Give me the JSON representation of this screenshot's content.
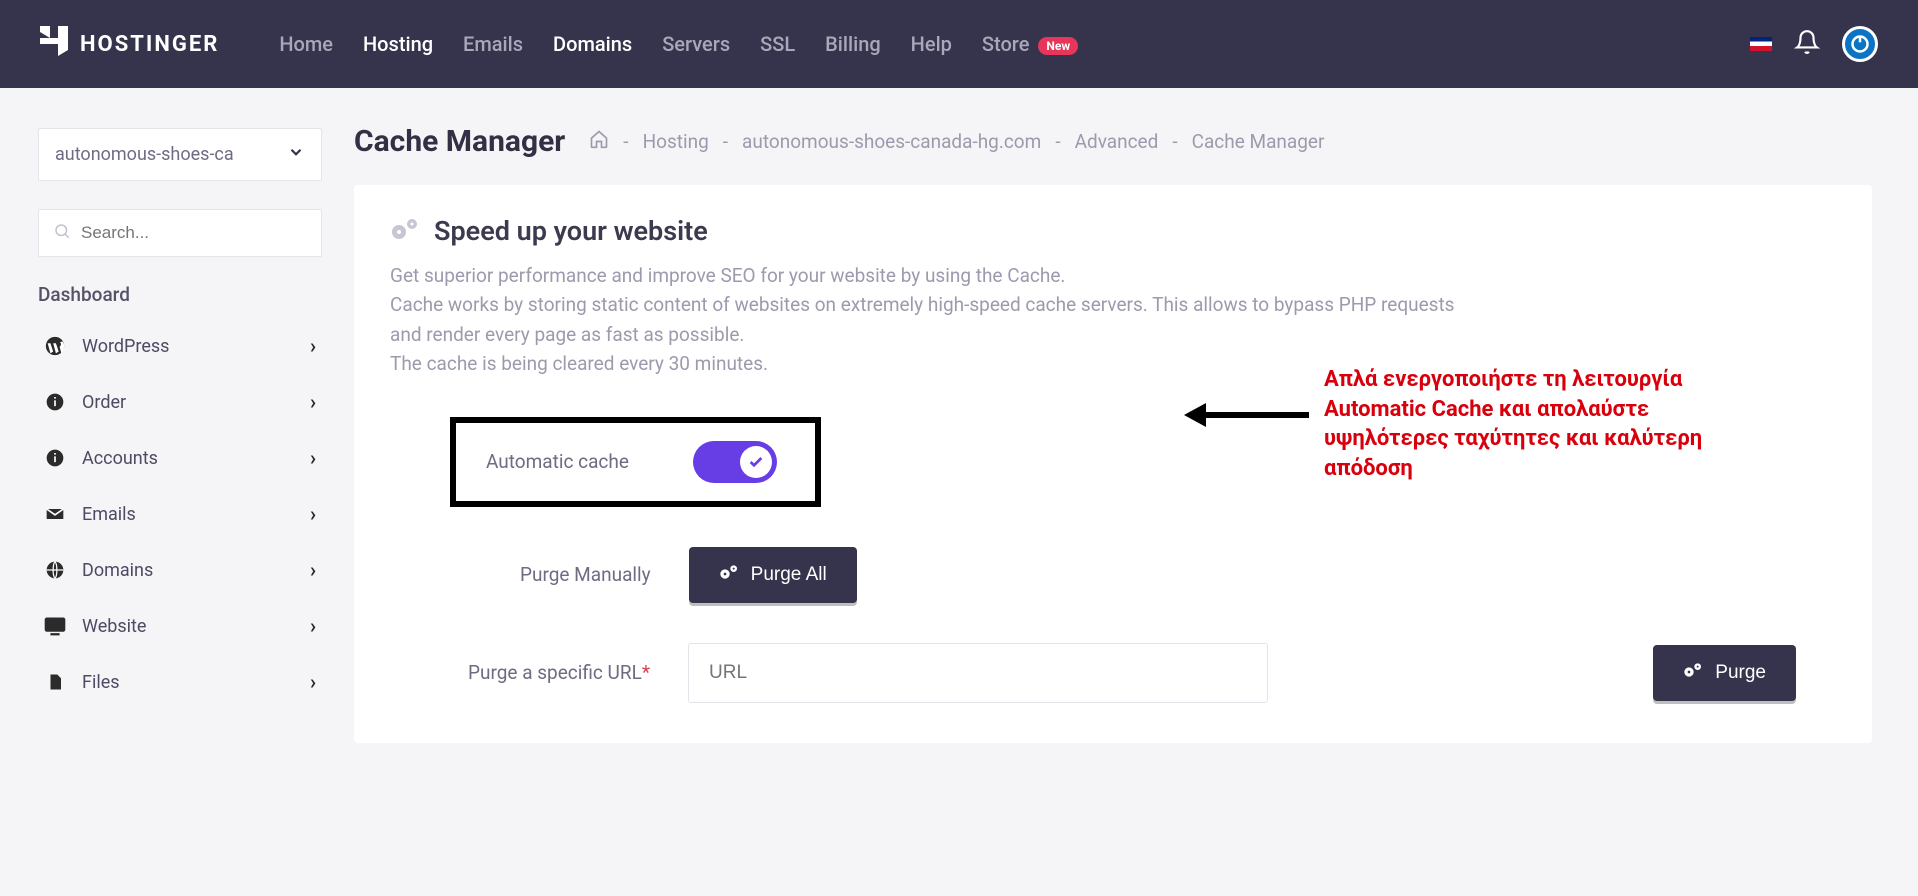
{
  "brand": "HOSTINGER",
  "nav": {
    "home": "Home",
    "hosting": "Hosting",
    "emails": "Emails",
    "domains": "Domains",
    "servers": "Servers",
    "ssl": "SSL",
    "billing": "Billing",
    "help": "Help",
    "store": "Store",
    "new_badge": "New"
  },
  "sidebar": {
    "domain": "autonomous-shoes-ca",
    "search_placeholder": "Search...",
    "heading": "Dashboard",
    "items": [
      {
        "label": "WordPress"
      },
      {
        "label": "Order"
      },
      {
        "label": "Accounts"
      },
      {
        "label": "Emails"
      },
      {
        "label": "Domains"
      },
      {
        "label": "Website"
      },
      {
        "label": "Files"
      }
    ]
  },
  "page": {
    "title": "Cache Manager",
    "crumbs": {
      "hosting": "Hosting",
      "domain": "autonomous-shoes-canada-hg.com",
      "advanced": "Advanced",
      "current": "Cache Manager"
    }
  },
  "card": {
    "title": "Speed up your website",
    "desc_line1": "Get superior performance and improve SEO for your website by using the Cache.",
    "desc_line2": "Cache works by storing static content of websites on extremely high-speed cache servers. This allows to bypass PHP requests and render every page as fast as possible.",
    "desc_line3": "The cache is being cleared every 30 minutes.",
    "labels": {
      "auto": "Automatic cache",
      "purge_manually": "Purge Manually",
      "purge_url": "Purge a specific URL"
    },
    "buttons": {
      "purge_all": "Purge All",
      "purge": "Purge"
    },
    "url_placeholder": "URL"
  },
  "callout": "Απλά ενεργοποιήστε τη λειτουργία Automatic Cache και απολαύστε υψηλότερες ταχύτητες και καλύτερη απόδοση"
}
